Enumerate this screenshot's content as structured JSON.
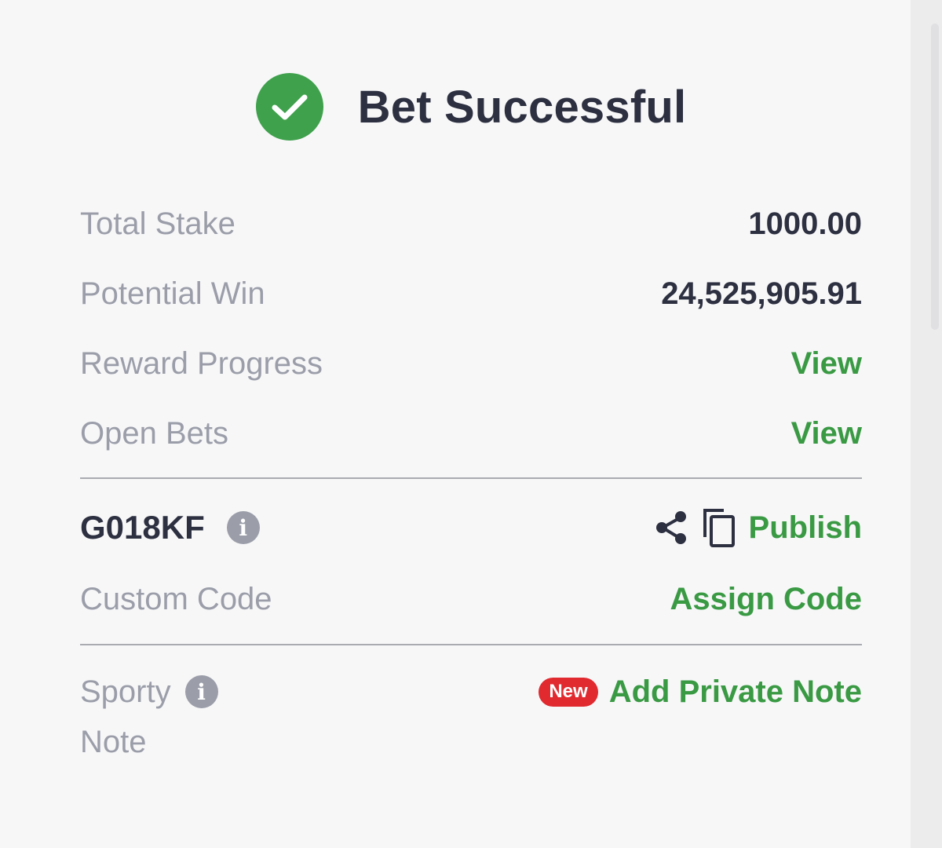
{
  "header": {
    "title": "Bet Successful",
    "icon": "check-circle-icon",
    "icon_color": "#3fa14c"
  },
  "summary": {
    "total_stake_label": "Total Stake",
    "total_stake_value": "1000.00",
    "potential_win_label": "Potential Win",
    "potential_win_value": "24,525,905.91",
    "reward_progress_label": "Reward Progress",
    "reward_progress_link": "View",
    "open_bets_label": "Open Bets",
    "open_bets_link": "View"
  },
  "booking": {
    "code": "G018KF",
    "info_icon_text": "i",
    "publish_label": "Publish",
    "custom_code_label": "Custom Code",
    "assign_code_label": "Assign Code"
  },
  "note": {
    "label_line1": "Sporty",
    "label_line2": "Note",
    "info_icon_text": "i",
    "new_badge": "New",
    "add_note_label": "Add Private Note"
  },
  "colors": {
    "accent_green": "#3a9a44",
    "badge_red": "#e02a2f",
    "text_dark": "#2d3040",
    "text_muted": "#9b9ea9"
  }
}
